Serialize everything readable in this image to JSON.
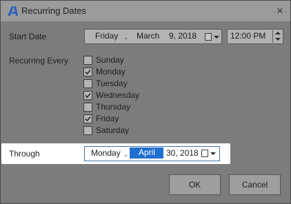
{
  "window": {
    "title": "Recurring Dates",
    "close_glyph": "×",
    "icon": "app-logo-icon"
  },
  "start_date": {
    "label": "Start Date",
    "weekday": "Friday",
    "sep": ",",
    "month": "March",
    "day_year": "9, 2018",
    "time": "12:00 PM"
  },
  "recurring": {
    "label": "Recurring Every",
    "days": [
      {
        "label": "Sunday",
        "checked": false
      },
      {
        "label": "Monday",
        "checked": true
      },
      {
        "label": "Tuesday",
        "checked": false
      },
      {
        "label": "Wednesday",
        "checked": true
      },
      {
        "label": "Thursday",
        "checked": false
      },
      {
        "label": "Friday",
        "checked": true
      },
      {
        "label": "Saturday",
        "checked": false
      }
    ]
  },
  "through": {
    "label": "Through",
    "weekday": "Monday",
    "sep": ",",
    "month": "April",
    "day_year": "30, 2018"
  },
  "buttons": {
    "ok": "OK",
    "cancel": "Cancel"
  },
  "colors": {
    "selection": "#1f6fd1",
    "focus_band": "#ffffff"
  }
}
